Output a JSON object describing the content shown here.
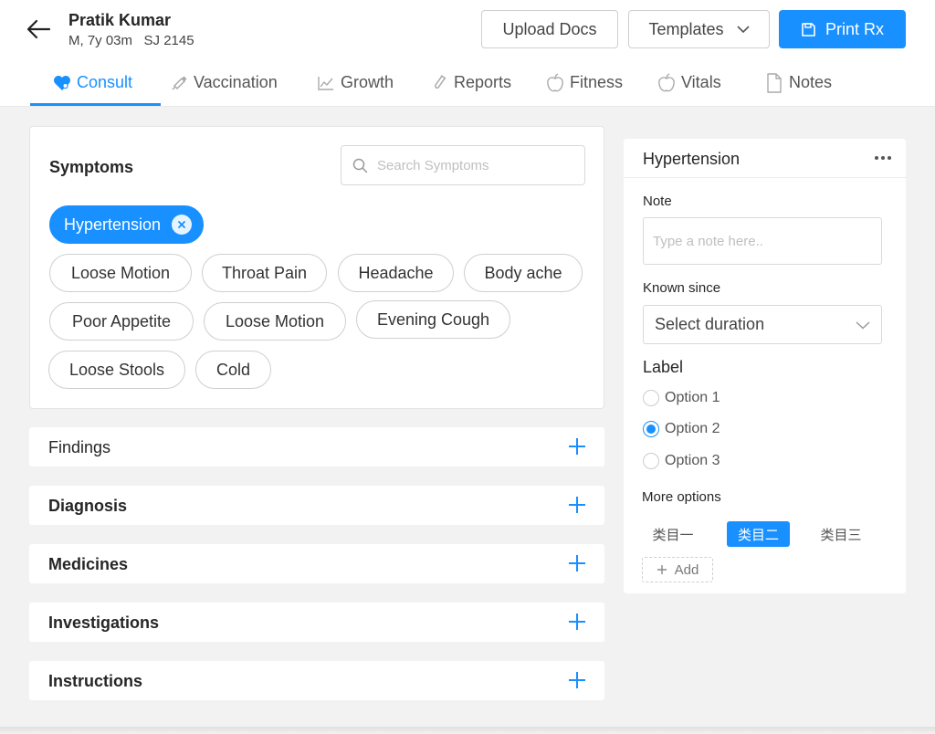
{
  "header": {
    "patient_name": "Pratik Kumar",
    "patient_meta": "M, 7y 03m   SJ 2145",
    "upload_label": "Upload Docs",
    "templates_label": "Templates",
    "print_label": "Print Rx"
  },
  "tabs": [
    {
      "label": "Consult",
      "icon": "heart-icon",
      "active": true
    },
    {
      "label": "Vaccination",
      "icon": "syringe-icon"
    },
    {
      "label": "Growth",
      "icon": "line-chart-icon"
    },
    {
      "label": "Reports",
      "icon": "test-tube-icon"
    },
    {
      "label": "Fitness",
      "icon": "apple-icon"
    },
    {
      "label": "Vitals",
      "icon": "apple-icon"
    },
    {
      "label": "Notes",
      "icon": "document-icon"
    }
  ],
  "symptoms": {
    "title": "Symptoms",
    "search_placeholder": "Search Symptoms",
    "selected": [
      "Hypertension"
    ],
    "chips": [
      "Loose Motion",
      "Throat Pain",
      "Headache",
      "Body ache",
      "Poor Appetite",
      "Loose Motion",
      "Evening Cough",
      "Loose Stools",
      "Cold"
    ]
  },
  "sections": [
    {
      "label": "Findings"
    },
    {
      "label": "Diagnosis"
    },
    {
      "label": "Medicines"
    },
    {
      "label": "Investigations"
    },
    {
      "label": "Instructions"
    }
  ],
  "panel": {
    "title": "Hypertension",
    "note_label": "Note",
    "note_placeholder": "Type a note here..",
    "known_since_label": "Known since",
    "duration_placeholder": "Select duration",
    "label_heading": "Label",
    "radio_options": [
      "Option 1",
      "Option 2",
      "Option 3"
    ],
    "radio_selected": "Option 2",
    "more_options_label": "More options",
    "tags": [
      "类目一",
      "类目二",
      "类目三"
    ],
    "tag_active": "类目二",
    "add_label": "Add"
  },
  "colors": {
    "accent": "#1890ff",
    "background": "#f2f2f2"
  }
}
